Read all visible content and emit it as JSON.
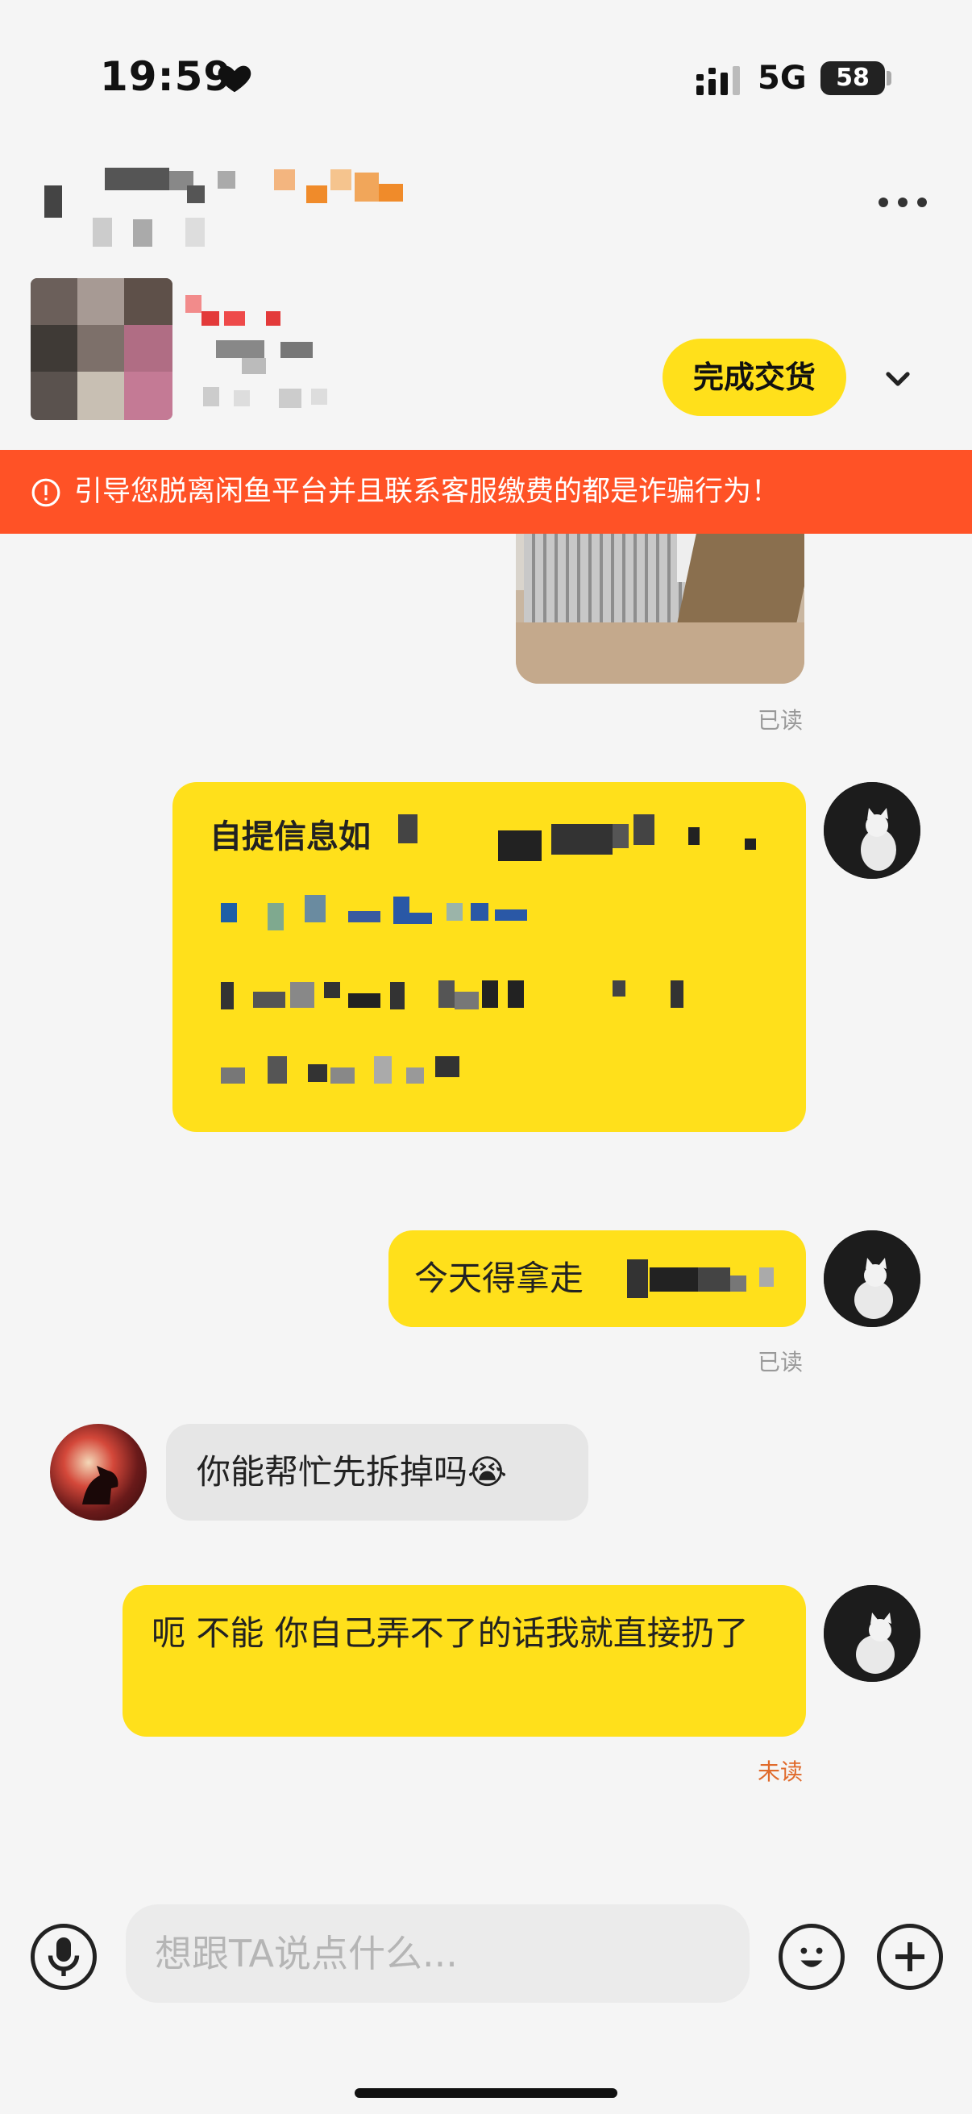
{
  "status_bar": {
    "time": "19:59",
    "network": "5G",
    "battery": "58"
  },
  "header": {
    "deal_button_label": "完成交货"
  },
  "warning_banner": {
    "text": "引导您脱离闲鱼平台并且联系客服缴费的都是诈骗行为！"
  },
  "messages": [
    {
      "sender": "me",
      "type": "image",
      "status": "已读"
    },
    {
      "sender": "me",
      "type": "text",
      "text": "自提信息如下，请按约定"
    },
    {
      "sender": "me",
      "type": "text",
      "text": "今天得拿走",
      "status": "已读"
    },
    {
      "sender": "other",
      "type": "text",
      "text": "你能帮忙先拆掉吗😭"
    },
    {
      "sender": "me",
      "type": "text",
      "text": "呃 不能 你自己弄不了的话我就直接扔了",
      "status": "未读"
    }
  ],
  "input_bar": {
    "placeholder": "想跟TA说点什么..."
  },
  "colors": {
    "accent_yellow": "#ffe01b",
    "warning_orange": "#ff5226",
    "unread_orange": "#e06a2b"
  }
}
